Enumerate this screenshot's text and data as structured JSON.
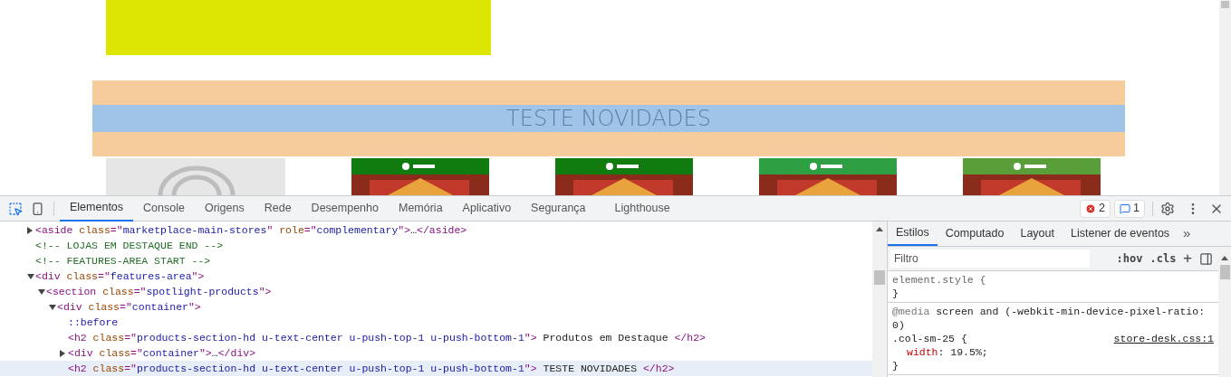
{
  "page": {
    "banner_title": "TESTE NOVIDADES",
    "products": [
      {
        "kind": "placeholder"
      },
      {
        "kind": "cover",
        "color": "#107c10"
      },
      {
        "kind": "cover",
        "color": "#107c10"
      },
      {
        "kind": "cover",
        "color": "#2ea043"
      },
      {
        "kind": "cover",
        "color": "#5a9e3a"
      }
    ]
  },
  "devtools": {
    "tabs": [
      {
        "label": "Elementos",
        "selected": true
      },
      {
        "label": "Console",
        "selected": false
      },
      {
        "label": "Origens",
        "selected": false
      },
      {
        "label": "Rede",
        "selected": false
      },
      {
        "label": "Desempenho",
        "selected": false
      },
      {
        "label": "Memória",
        "selected": false
      },
      {
        "label": "Aplicativo",
        "selected": false
      },
      {
        "label": "Segurança",
        "selected": false
      },
      {
        "label": "Lighthouse",
        "selected": false
      }
    ],
    "errors": "2",
    "messages": "1",
    "dom": [
      {
        "expanded": false,
        "selected": false,
        "segments": [
          {
            "kind": "tag",
            "text": "<aside "
          },
          {
            "kind": "attr",
            "text": "class"
          },
          {
            "kind": "punct",
            "text": "=\""
          },
          {
            "kind": "value",
            "text": "marketplace-main-stores"
          },
          {
            "kind": "punct",
            "text": "\" "
          },
          {
            "kind": "attr",
            "text": "role"
          },
          {
            "kind": "punct",
            "text": "=\""
          },
          {
            "kind": "value",
            "text": "complementary"
          },
          {
            "kind": "punct",
            "text": "\">"
          },
          {
            "kind": "text",
            "text": "…"
          },
          {
            "kind": "tag",
            "text": "</aside>"
          }
        ]
      },
      {
        "selected": false,
        "segments": [
          {
            "kind": "comment",
            "text": "<!-- LOJAS EM DESTAQUE END -->"
          }
        ]
      },
      {
        "selected": false,
        "segments": [
          {
            "kind": "comment",
            "text": "<!-- FEATURES-AREA START -->"
          }
        ]
      },
      {
        "expanded": true,
        "selected": false,
        "segments": [
          {
            "kind": "tag",
            "text": "<div "
          },
          {
            "kind": "attr",
            "text": "class"
          },
          {
            "kind": "punct",
            "text": "=\""
          },
          {
            "kind": "value",
            "text": "features-area"
          },
          {
            "kind": "punct",
            "text": "\">"
          }
        ],
        "children": [
          {
            "expanded": true,
            "selected": false,
            "segments": [
              {
                "kind": "tag",
                "text": "<section "
              },
              {
                "kind": "attr",
                "text": "class"
              },
              {
                "kind": "punct",
                "text": "=\""
              },
              {
                "kind": "value",
                "text": "spotlight-products"
              },
              {
                "kind": "punct",
                "text": "\">"
              }
            ],
            "children": [
              {
                "expanded": true,
                "selected": false,
                "segments": [
                  {
                    "kind": "tag",
                    "text": "<div "
                  },
                  {
                    "kind": "attr",
                    "text": "class"
                  },
                  {
                    "kind": "punct",
                    "text": "=\""
                  },
                  {
                    "kind": "value",
                    "text": "container"
                  },
                  {
                    "kind": "punct",
                    "text": "\">"
                  }
                ],
                "children": [
                  {
                    "selected": false,
                    "segments": [
                      {
                        "kind": "pseudo",
                        "text": "::before"
                      }
                    ]
                  },
                  {
                    "selected": false,
                    "segments": [
                      {
                        "kind": "tag",
                        "text": "<h2 "
                      },
                      {
                        "kind": "attr",
                        "text": "class"
                      },
                      {
                        "kind": "punct",
                        "text": "=\""
                      },
                      {
                        "kind": "value",
                        "text": "products-section-hd u-text-center u-push-top-1 u-push-bottom-1"
                      },
                      {
                        "kind": "punct",
                        "text": "\">"
                      },
                      {
                        "kind": "text",
                        "text": " Produtos em Destaque "
                      },
                      {
                        "kind": "tag",
                        "text": "</h2>"
                      }
                    ]
                  },
                  {
                    "expanded": false,
                    "selected": false,
                    "segments": [
                      {
                        "kind": "tag",
                        "text": "<div "
                      },
                      {
                        "kind": "attr",
                        "text": "class"
                      },
                      {
                        "kind": "punct",
                        "text": "=\""
                      },
                      {
                        "kind": "value",
                        "text": "container"
                      },
                      {
                        "kind": "punct",
                        "text": "\">"
                      },
                      {
                        "kind": "text",
                        "text": "…"
                      },
                      {
                        "kind": "tag",
                        "text": "</div>"
                      }
                    ]
                  },
                  {
                    "selected": true,
                    "segments": [
                      {
                        "kind": "tag",
                        "text": "<h2 "
                      },
                      {
                        "kind": "attr",
                        "text": "class"
                      },
                      {
                        "kind": "punct",
                        "text": "=\""
                      },
                      {
                        "kind": "value",
                        "text": "products-section-hd u-text-center u-push-top-1 u-push-bottom-1"
                      },
                      {
                        "kind": "punct",
                        "text": "\">"
                      },
                      {
                        "kind": "text",
                        "text": " TESTE NOVIDADES "
                      },
                      {
                        "kind": "tag",
                        "text": "</h2>"
                      }
                    ]
                  }
                ]
              }
            ]
          }
        ]
      }
    ],
    "styles_tabs": [
      {
        "label": "Estilos",
        "selected": true
      },
      {
        "label": "Computado",
        "selected": false
      },
      {
        "label": "Layout",
        "selected": false
      },
      {
        "label": "Listener de eventos",
        "selected": false
      }
    ],
    "more_tabs": "»",
    "filter": {
      "placeholder": "Filtro"
    },
    "filter_buttons": [
      ":hov",
      ".cls",
      "+"
    ],
    "rules": [
      {
        "kind": "inline",
        "selector": "element.style {",
        "close": "}"
      },
      {
        "kind": "rule",
        "media_keyword": "@media",
        "media_query": "screen and (-webkit-min-device-pixel-ratio: 0)",
        "selector": ".col-sm-25 {",
        "source": "store-desk.css:1",
        "properties": [
          {
            "name": "width",
            "value": ": 19.5%;"
          }
        ],
        "close": "}"
      }
    ]
  }
}
